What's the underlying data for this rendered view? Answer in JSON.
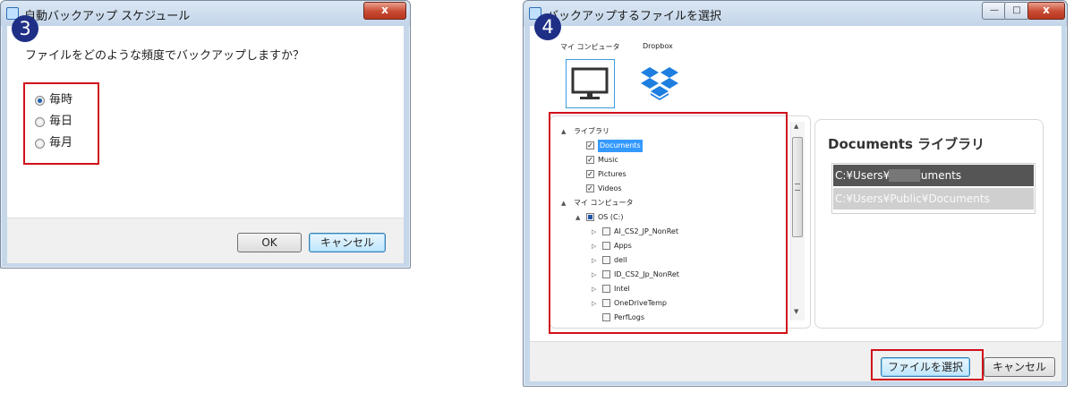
{
  "badges": {
    "step3": "3",
    "step4": "4"
  },
  "window1": {
    "title": "自動バックアップ スケジュール",
    "close_label": "x",
    "question": "ファイルをどのような頻度でバックアップしますか？",
    "options": [
      {
        "label": "毎時",
        "selected": true
      },
      {
        "label": "毎日",
        "selected": false
      },
      {
        "label": "毎月",
        "selected": false
      }
    ],
    "ok_label": "OK",
    "cancel_label": "キャンセル"
  },
  "window2": {
    "title": "バックアップするファイルを選択",
    "minimize_label": "—",
    "maximize_label": "□",
    "close_label": "x",
    "sources": [
      {
        "label": "マイ コンピュータ",
        "icon": "monitor-icon",
        "selected": true
      },
      {
        "label": "Dropbox",
        "icon": "dropbox-icon",
        "selected": false
      }
    ],
    "tree": [
      {
        "label": "ライブラリ",
        "level": 0,
        "expander": "▲",
        "checkbox": null,
        "selected": false
      },
      {
        "label": "Documents",
        "level": 1,
        "expander": "",
        "checkbox": "checked",
        "selected": true
      },
      {
        "label": "Music",
        "level": 1,
        "expander": "",
        "checkbox": "checked",
        "selected": false
      },
      {
        "label": "Pictures",
        "level": 1,
        "expander": "",
        "checkbox": "checked",
        "selected": false
      },
      {
        "label": "Videos",
        "level": 1,
        "expander": "",
        "checkbox": "checked",
        "selected": false
      },
      {
        "label": "マイ コンピュータ",
        "level": 0,
        "expander": "▲",
        "checkbox": null,
        "selected": false
      },
      {
        "label": "OS (C:)",
        "level": 1,
        "expander": "▲",
        "checkbox": "partial",
        "selected": false
      },
      {
        "label": "AI_CS2_JP_NonRet",
        "level": 2,
        "expander": "▷",
        "checkbox": "unchecked",
        "selected": false
      },
      {
        "label": "Apps",
        "level": 2,
        "expander": "▷",
        "checkbox": "unchecked",
        "selected": false
      },
      {
        "label": "dell",
        "level": 2,
        "expander": "▷",
        "checkbox": "unchecked",
        "selected": false
      },
      {
        "label": "ID_CS2_Jp_NonRet",
        "level": 2,
        "expander": "▷",
        "checkbox": "unchecked",
        "selected": false
      },
      {
        "label": "Intel",
        "level": 2,
        "expander": "▷",
        "checkbox": "unchecked",
        "selected": false
      },
      {
        "label": "OneDriveTemp",
        "level": 2,
        "expander": "▷",
        "checkbox": "unchecked",
        "selected": false
      },
      {
        "label": "PerfLogs",
        "level": 2,
        "expander": "",
        "checkbox": "unchecked",
        "selected": false
      }
    ],
    "library_title": "Documents ライブラリ",
    "library_paths": [
      {
        "path": "C:¥Users¥      ¥Documents",
        "selected": true
      },
      {
        "path": "C:¥Users¥Public¥Documents",
        "selected": false
      }
    ],
    "select_label": "ファイルを選択",
    "cancel_label": "キャンセル"
  },
  "colors": {
    "accent_red": "#d0101a",
    "badge_blue": "#1f2f86",
    "dropbox_blue": "#1f7fe0",
    "selection_blue": "#3399ff",
    "path_selected_bg": "#555555",
    "path_unselected_bg": "#cfcfcf"
  }
}
